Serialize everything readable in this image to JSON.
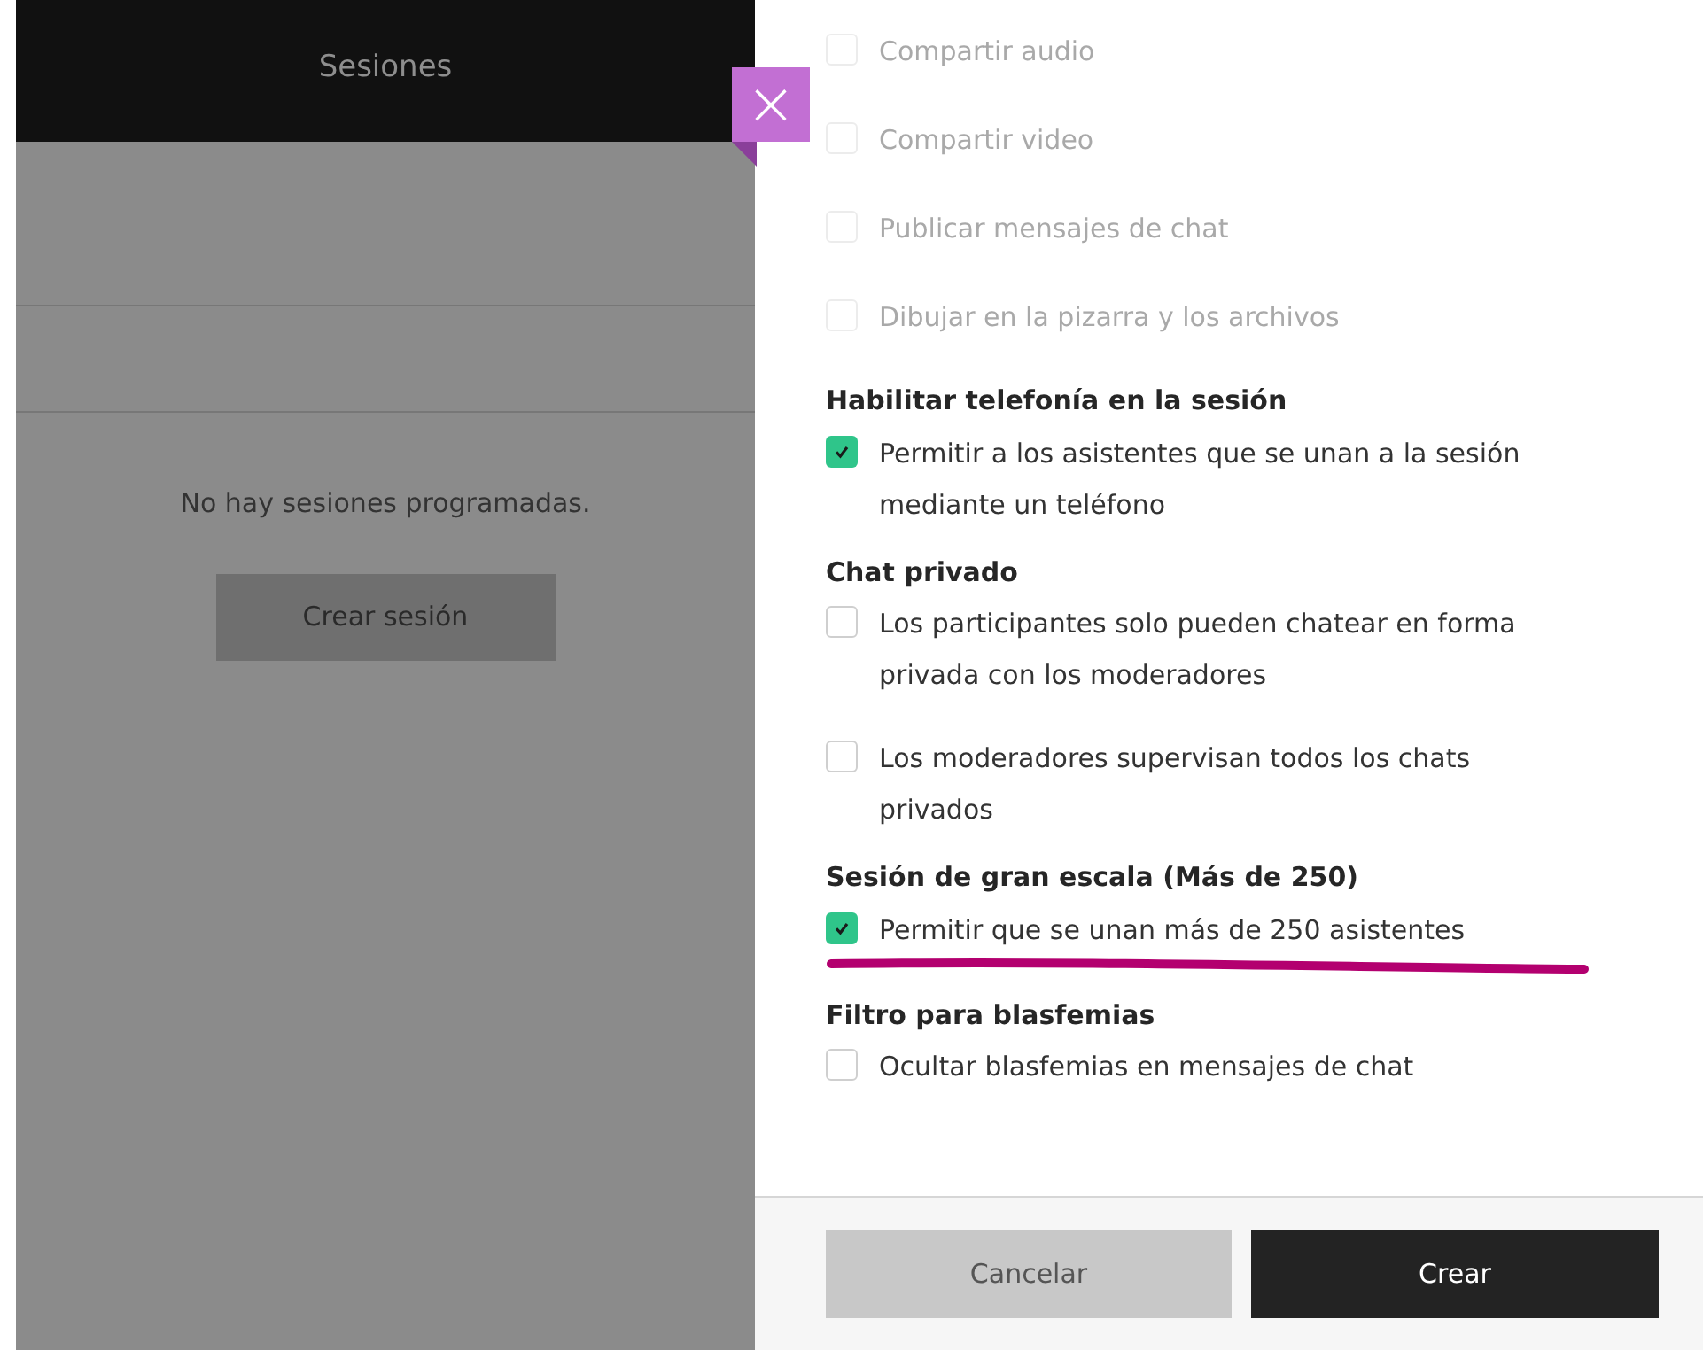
{
  "sessions_panel": {
    "title": "Sesiones",
    "empty_message": "No hay sesiones programadas.",
    "create_button": "Crear sesión"
  },
  "close_button": {
    "label": "×"
  },
  "settings": [
    {
      "options": [
        {
          "label": "Compartir audio",
          "checked": false,
          "disabled": true
        },
        {
          "label": "Compartir video",
          "checked": false,
          "disabled": true
        },
        {
          "label": "Publicar mensajes de chat",
          "checked": false,
          "disabled": true
        },
        {
          "label": "Dibujar en la pizarra y los archivos",
          "checked": false,
          "disabled": true
        }
      ]
    },
    {
      "heading": "Habilitar telefonía en la sesión",
      "options": [
        {
          "label": "Permitir a los asistentes que se unan a la sesión mediante un teléfono",
          "checked": true,
          "disabled": false
        }
      ]
    },
    {
      "heading": "Chat privado",
      "options": [
        {
          "label": "Los participantes solo pueden chatear en forma privada con los moderadores",
          "checked": false,
          "disabled": false
        },
        {
          "label": "Los moderadores supervisan todos los chats privados",
          "checked": false,
          "disabled": false
        }
      ]
    },
    {
      "heading": "Sesión de gran escala (Más de 250)",
      "options": [
        {
          "label": "Permitir que se unan más de 250 asistentes",
          "checked": true,
          "disabled": false,
          "underlined": true
        }
      ]
    },
    {
      "heading": "Filtro para blasfemias",
      "options": [
        {
          "label": "Ocultar blasfemias en mensajes de chat",
          "checked": false,
          "disabled": false
        }
      ]
    }
  ],
  "footer": {
    "cancel_button": "Cancelar",
    "create_button": "Crear"
  }
}
